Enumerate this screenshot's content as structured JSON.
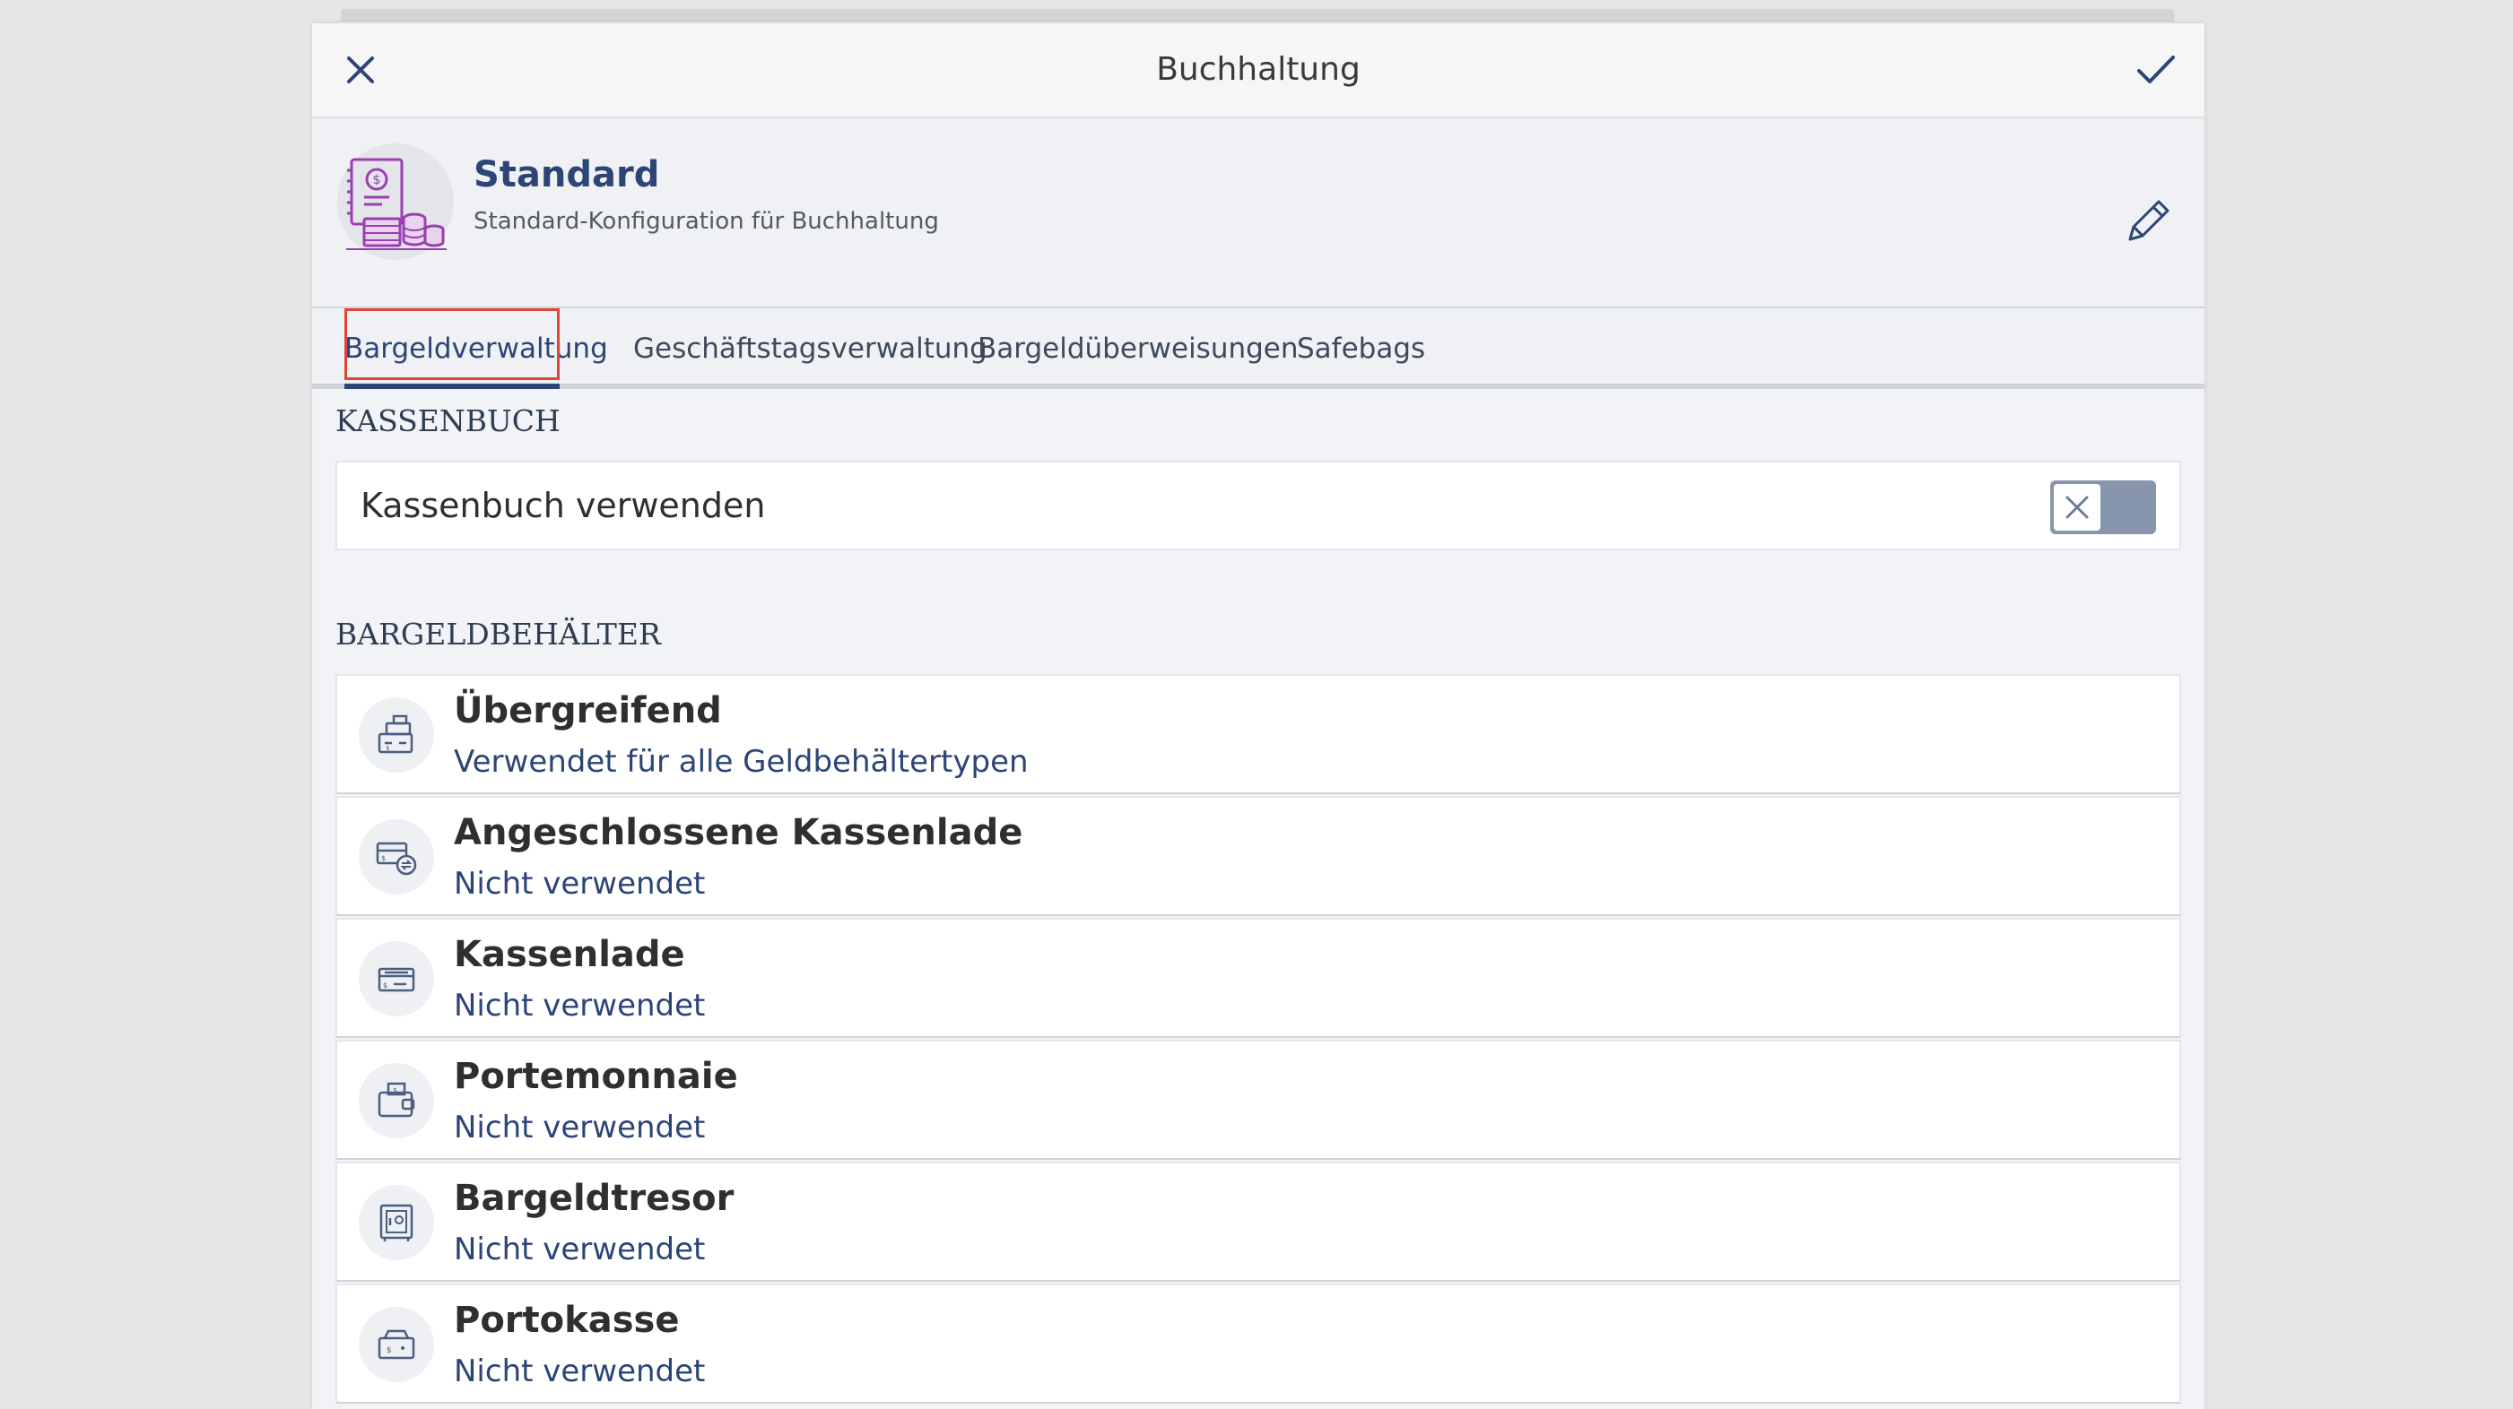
{
  "dialog": {
    "title": "Buchhaltung"
  },
  "profile": {
    "name": "Standard",
    "description": "Standard-Konfiguration für Buchhaltung"
  },
  "tabs": [
    {
      "label": "Bargeldverwaltung",
      "active": true
    },
    {
      "label": "Geschäftstagsverwaltung",
      "active": false
    },
    {
      "label": "Bargeldüberweisungen",
      "active": false
    },
    {
      "label": "Safebags",
      "active": false
    }
  ],
  "cashbook": {
    "section_title": "KASSENBUCH",
    "toggle_label": "Kassenbuch verwenden",
    "enabled": false
  },
  "containers": {
    "section_title": "BARGELDBEHÄLTER",
    "items": [
      {
        "title": "Übergreifend",
        "subtitle": "Verwendet für alle Geldbehältertypen",
        "icon": "register-icon"
      },
      {
        "title": "Angeschlossene Kassenlade",
        "subtitle": "Nicht verwendet",
        "icon": "connected-drawer-icon"
      },
      {
        "title": "Kassenlade",
        "subtitle": "Nicht verwendet",
        "icon": "cash-drawer-icon"
      },
      {
        "title": "Portemonnaie",
        "subtitle": "Nicht verwendet",
        "icon": "wallet-icon"
      },
      {
        "title": "Bargeldtresor",
        "subtitle": "Nicht verwendet",
        "icon": "safe-icon"
      },
      {
        "title": "Portokasse",
        "subtitle": "Nicht verwendet",
        "icon": "petty-cash-icon"
      }
    ]
  },
  "colors": {
    "accent": "#2c4576",
    "highlight": "#e0453a",
    "toggle_off": "#8795ad",
    "avatar_icon": "#9b3fb0"
  }
}
